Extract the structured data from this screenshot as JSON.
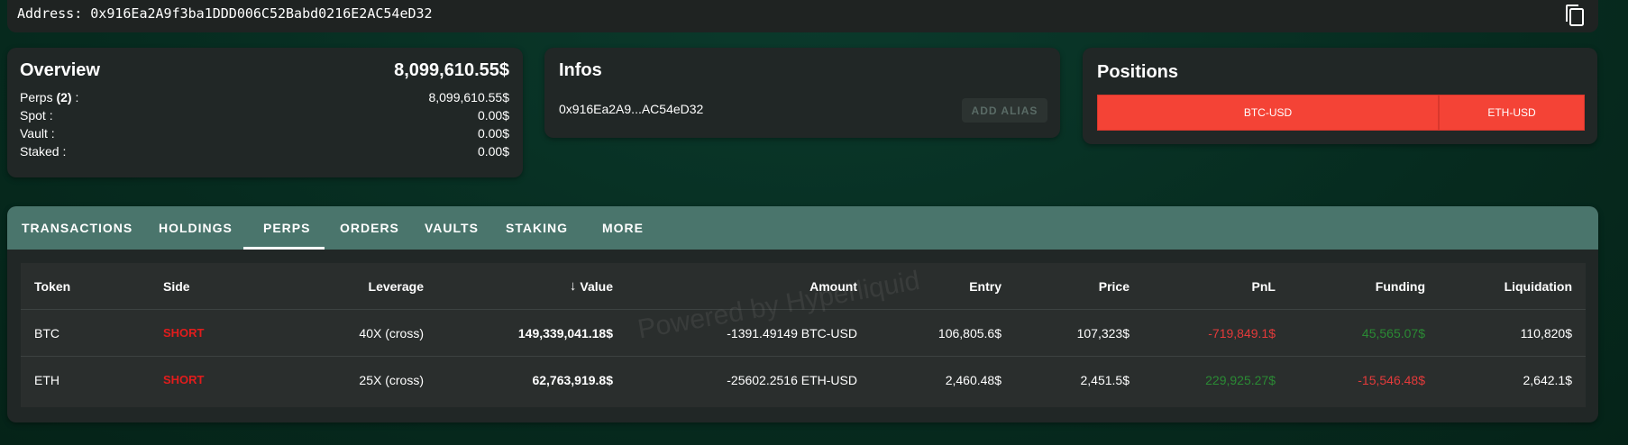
{
  "address_bar": {
    "text": "Address: 0x916Ea2A9f3ba1DDD006C52Babd0216E2AC54eD32",
    "copy_icon": "copy-icon"
  },
  "overview": {
    "title": "Overview",
    "total": "8,099,610.55$",
    "rows": [
      {
        "label": "Perps ",
        "count": "(2)",
        "suffix": " :",
        "value": "8,099,610.55$"
      },
      {
        "label": "Spot :",
        "value": "0.00$"
      },
      {
        "label": "Vault :",
        "value": "0.00$"
      },
      {
        "label": "Staked :",
        "value": "0.00$"
      }
    ]
  },
  "infos": {
    "title": "Infos",
    "address_short": "0x916Ea2A9...AC54eD32",
    "add_alias_label": "ADD ALIAS"
  },
  "positions": {
    "title": "Positions",
    "segments": [
      {
        "label": "BTC-USD",
        "share": 0.7
      },
      {
        "label": "ETH-USD",
        "share": 0.3
      }
    ],
    "color": "#f44336"
  },
  "tabs": [
    "TRANSACTIONS",
    "HOLDINGS",
    "PERPS",
    "ORDERS",
    "VAULTS",
    "STAKING",
    "MORE"
  ],
  "active_tab": "PERPS",
  "table": {
    "headers": [
      "Token",
      "Side",
      "Leverage",
      "Value",
      "Amount",
      "Entry",
      "Price",
      "PnL",
      "Funding",
      "Liquidation"
    ],
    "sort_icon": "arrow-down-icon",
    "rows": [
      {
        "token": "BTC",
        "side": "SHORT",
        "leverage": "40X (cross)",
        "value": "149,339,041.18$",
        "amount": "-1391.49149 BTC-USD",
        "entry": "106,805.6$",
        "price": "107,323$",
        "pnl": "-719,849.1$",
        "funding": "45,565.07$",
        "liquidation": "110,820$"
      },
      {
        "token": "ETH",
        "side": "SHORT",
        "leverage": "25X (cross)",
        "value": "62,763,919.8$",
        "amount": "-25602.2516 ETH-USD",
        "entry": "2,460.48$",
        "price": "2,451.5$",
        "pnl": "229,925.27$",
        "funding": "-15,546.48$",
        "liquidation": "2,642.1$"
      }
    ]
  },
  "watermark": "Powered by Hyperliquid",
  "colors": {
    "accent_tab": "#4a756c",
    "short": "#e11c1c",
    "positive": "#2a8a34",
    "negative": "#e33a3a"
  }
}
